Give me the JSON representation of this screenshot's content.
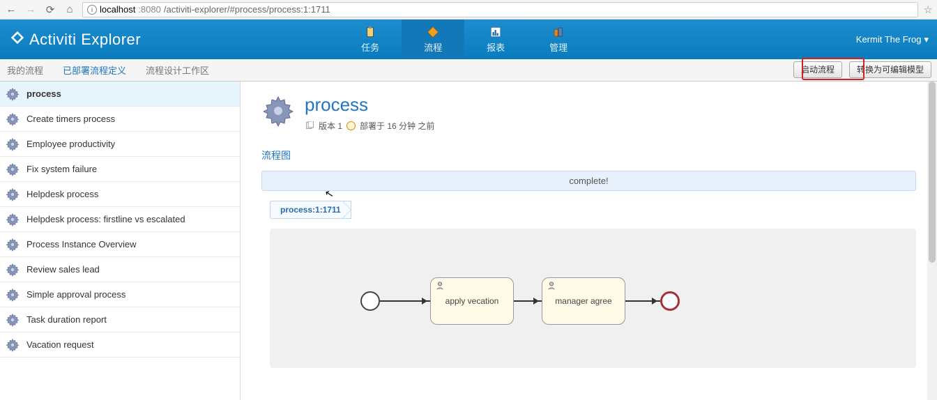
{
  "browser": {
    "host": "localhost",
    "port": ":8080",
    "path": "/activiti-explorer/#process/process:1:1711"
  },
  "logo": {
    "brand": "Activiti",
    "sub": "Explorer"
  },
  "topnav": [
    {
      "label": "任务",
      "icon": "clipboard"
    },
    {
      "label": "流程",
      "icon": "diamond",
      "active": true
    },
    {
      "label": "报表",
      "icon": "chart"
    },
    {
      "label": "管理",
      "icon": "buildings"
    }
  ],
  "user": {
    "name": "Kermit The Frog"
  },
  "subnav": {
    "tabs": [
      "我的流程",
      "已部署流程定义",
      "流程设计工作区"
    ],
    "activeIndex": 1,
    "buttons": {
      "start": "启动流程",
      "convert": "转换为可编辑模型"
    }
  },
  "sidebar": [
    "process",
    "Create timers process",
    "Employee productivity",
    "Fix system failure",
    "Helpdesk process",
    "Helpdesk process: firstline vs escalated",
    "Process Instance Overview",
    "Review sales lead",
    "Simple approval process",
    "Task duration report",
    "Vacation request"
  ],
  "page": {
    "title": "process",
    "version_label": "版本 1",
    "deploy_label": "部署于 16 分钟 之前",
    "section": "流程图",
    "status": "complete!",
    "breadcrumb": "process:1:1711"
  },
  "bpmn": {
    "task1": "apply vecation",
    "task2": "manager agree"
  }
}
